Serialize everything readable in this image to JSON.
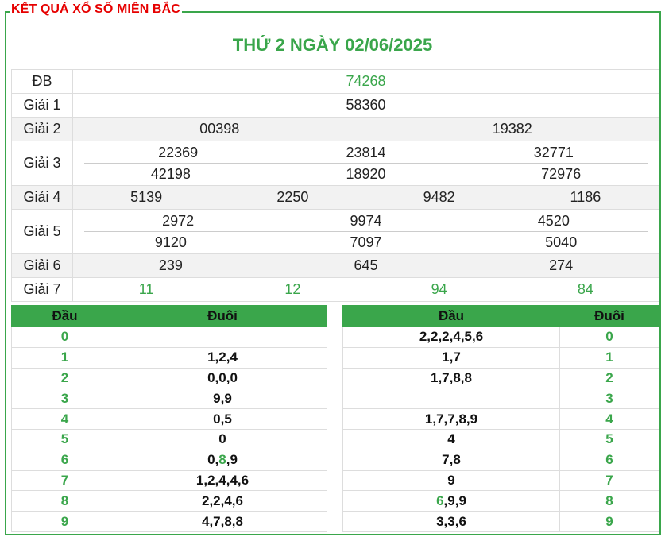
{
  "header": {
    "frame_title": "KẾT QUẢ XỔ SỐ MIỀN BẮC",
    "date_title": "THỨ 2 NGÀY 02/06/2025"
  },
  "prizes": {
    "db": {
      "label": "ĐB",
      "values": [
        "74268"
      ]
    },
    "g1": {
      "label": "Giải 1",
      "values": [
        "58360"
      ]
    },
    "g2": {
      "label": "Giải 2",
      "values": [
        "00398",
        "19382"
      ]
    },
    "g3": {
      "label": "Giải 3",
      "values": [
        "22369",
        "23814",
        "32771",
        "42198",
        "18920",
        "72976"
      ]
    },
    "g4": {
      "label": "Giải 4",
      "values": [
        "5139",
        "2250",
        "9482",
        "1186"
      ]
    },
    "g5": {
      "label": "Giải 5",
      "values": [
        "2972",
        "9974",
        "4520",
        "9120",
        "7097",
        "5040"
      ]
    },
    "g6": {
      "label": "Giải 6",
      "values": [
        "239",
        "645",
        "274"
      ]
    },
    "g7": {
      "label": "Giải 7",
      "values": [
        "11",
        "12",
        "94",
        "84"
      ]
    }
  },
  "dau_table": {
    "head_label": "Đầu",
    "tail_label": "Đuôi",
    "rows": [
      {
        "head": "0",
        "tail": ""
      },
      {
        "head": "1",
        "tail": "1,2,4"
      },
      {
        "head": "2",
        "tail": "0,0,0"
      },
      {
        "head": "3",
        "tail": "9,9"
      },
      {
        "head": "4",
        "tail": "0,5"
      },
      {
        "head": "5",
        "tail": "0"
      },
      {
        "head": "6",
        "tail_parts": [
          "0,",
          "8",
          ",9"
        ]
      },
      {
        "head": "7",
        "tail": "1,2,4,4,6"
      },
      {
        "head": "8",
        "tail": "2,2,4,6"
      },
      {
        "head": "9",
        "tail": "4,7,8,8"
      }
    ]
  },
  "duoi_table": {
    "head_label": "Đầu",
    "tail_label": "Đuôi",
    "rows": [
      {
        "head": "2,2,2,4,5,6",
        "tail": "0"
      },
      {
        "head": "1,7",
        "tail": "1"
      },
      {
        "head": "1,7,8,8",
        "tail": "2"
      },
      {
        "head": "",
        "tail": "3"
      },
      {
        "head": "1,7,7,8,9",
        "tail": "4"
      },
      {
        "head": "4",
        "tail": "5"
      },
      {
        "head": "7,8",
        "tail": "6"
      },
      {
        "head": "9",
        "tail": "7"
      },
      {
        "head_parts": [
          "6",
          ",9,9"
        ],
        "tail": "8"
      },
      {
        "head": "3,3,6",
        "tail": "9"
      }
    ]
  },
  "colors": {
    "accent": "#3aa64b",
    "title_red": "#e60000"
  }
}
